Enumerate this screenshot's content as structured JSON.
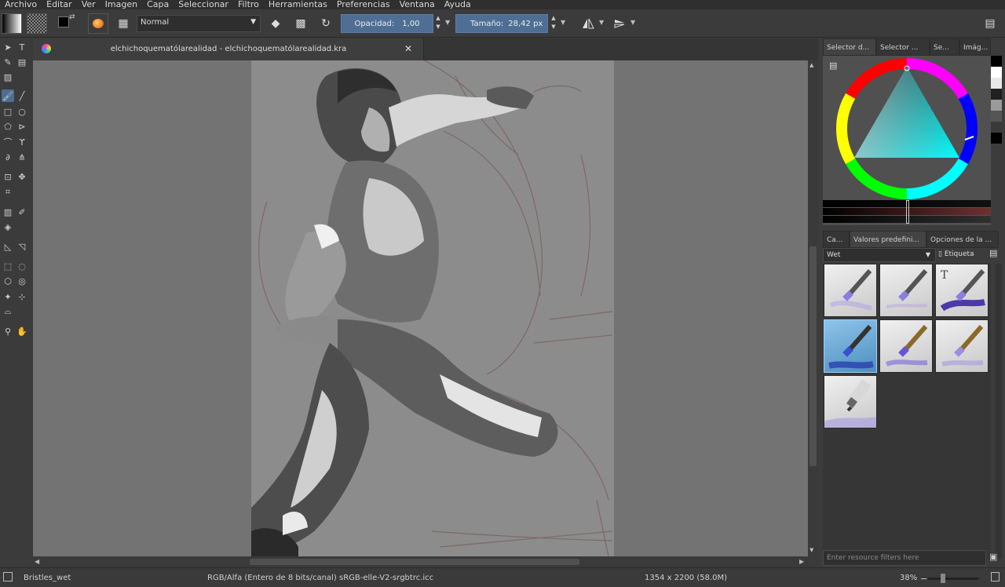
{
  "menu": [
    "Archivo",
    "Editar",
    "Ver",
    "Imagen",
    "Capa",
    "Seleccionar",
    "Filtro",
    "Herramientas",
    "Preferencias",
    "Ventana",
    "Ayuda"
  ],
  "toolbar": {
    "blend_mode": "Normal",
    "opacity_label": "Opacidad:",
    "opacity_value": "1,00",
    "opacity_fraction": 1.0,
    "size_label": "Tamaño:",
    "size_value": "28,42 px",
    "icons": {
      "gradient": "gradient-icon",
      "pattern": "pattern-icon",
      "preset": "brush-preset-icon",
      "grid": "preset-grid-icon",
      "eraser": "eraser-icon",
      "alpha": "alpha-lock-icon",
      "reload": "reload-icon",
      "mirror_h": "mirror-horizontal-icon",
      "mirror_v": "mirror-vertical-icon",
      "workspace": "workspace-icon"
    }
  },
  "document": {
    "tab_title": "elchichoquematólarealidad - elchichoquematólarealidad.kra"
  },
  "docker": {
    "top_tabs": [
      "Selector d...",
      "Selector ...",
      "Se...",
      "Imág..."
    ],
    "active_top_tab": 0,
    "selected_color": "#0a1a1f",
    "hue_marker_color": "#00ffff",
    "swatches": [
      "#000000",
      "#ffffff",
      "#e8e8e8",
      "#202020",
      "#9a9a9a",
      "#555555",
      "#3a3a3a",
      "#000000"
    ],
    "preset_tabs": [
      "Ca...",
      "Valores predefini...",
      "Opciones de la ..."
    ],
    "active_preset_tab": 1,
    "preset_filter": "Wet",
    "tag_label": "Etiqueta",
    "resource_filter_placeholder": "Enter resource filters here"
  },
  "status": {
    "preset_name": "Bristles_wet",
    "color_space": "RGB/Alfa (Entero de 8 bits/canal)  sRGB-elle-V2-srgbtrc.icc",
    "dimensions": "1354 x 2200 (58.0M)",
    "zoom": "38%"
  }
}
